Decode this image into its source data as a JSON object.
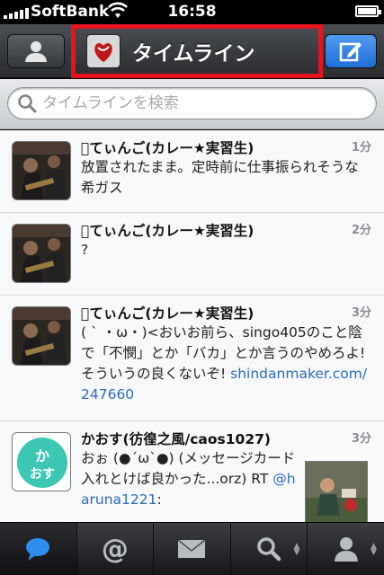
{
  "status_bar": {
    "carrier": "SoftBank",
    "time": "16:58"
  },
  "navbar": {
    "title": "タイムライン"
  },
  "search": {
    "placeholder": "タイムラインを検索"
  },
  "tweets": [
    {
      "name": "てぃんご(カレー★実習生)",
      "time": "1分",
      "text": "放置されたまま。定時前に仕事振られそうな希ガス"
    },
    {
      "name": "てぃんご(カレー★実習生)",
      "time": "2分",
      "text": "?"
    },
    {
      "name": "てぃんご(カレー★実習生)",
      "time": "3分",
      "text": "( ` ・ω・)<おいお前ら、singo405のこと陰で「不憫」とか「バカ」とか言うのやめろよ!そういうの良くないぞ!",
      "link": "shindanmaker.com/247660"
    },
    {
      "name": "かおす(彷徨之風/caos1027)",
      "time": "3分",
      "text": "おぉ (●´ω`●) (メッセージカード入れとけば良かった...orz) RT ",
      "mention": "@haruna1221",
      "text_after": ":"
    }
  ],
  "tabs": [
    {
      "name": "timeline",
      "icon": "speech-bubble-icon"
    },
    {
      "name": "mentions",
      "icon": "at-icon"
    },
    {
      "name": "messages",
      "icon": "envelope-icon"
    },
    {
      "name": "search",
      "icon": "search-icon"
    },
    {
      "name": "profile",
      "icon": "person-icon"
    }
  ],
  "colors": {
    "accent_blue": "#2d6cc0",
    "highlight_red": "#e8131c",
    "compose_blue": "#1f6fd8"
  }
}
